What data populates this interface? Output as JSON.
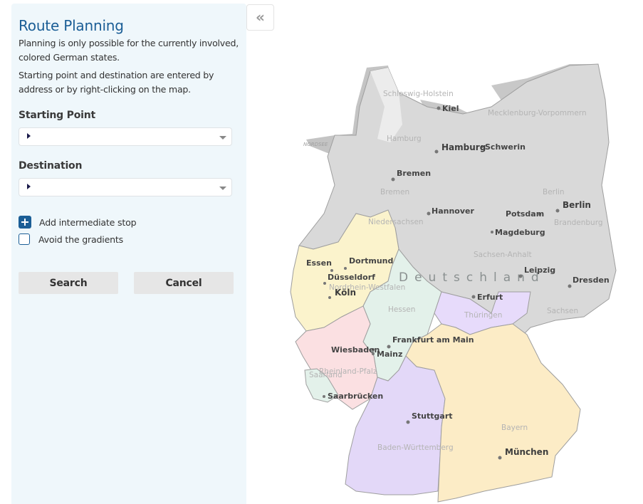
{
  "sidebar": {
    "title": "Route Planning",
    "description_1": "Planning is only possible for the currently involved, colored German states.",
    "description_2": "Starting point and destination are entered by address or by right-clicking on the map.",
    "starting_point": {
      "label": "Starting Point",
      "value": ""
    },
    "destination": {
      "label": "Destination",
      "value": ""
    },
    "add_stop_label": "Add intermediate stop",
    "avoid_gradients_label": "Avoid the gradients",
    "avoid_gradients_checked": false,
    "search_label": "Search",
    "cancel_label": "Cancel",
    "accent_color": "#1b5e96"
  },
  "collapse_button": {
    "icon": "double-chevron-left-icon",
    "glyph": "«"
  },
  "map": {
    "country_label": "Deutschland",
    "sea_label": "NORDSEE",
    "state_colors": {
      "inactive": "#d9d9d9",
      "nordrhein_westfalen": "#fbf3cc",
      "hessen": "#e3f1ea",
      "rheinland_pfalz": "#fbe0e2",
      "saarland": "#e3f1ea",
      "thueringen": "#e7dbfb",
      "baden_wuerttemberg": "#e3d8f8",
      "bayern": "#fcecc6"
    },
    "states": [
      "Schleswig-Holstein",
      "Hamburg",
      "Mecklenburg-Vorpommern",
      "Bremen",
      "Niedersachsen",
      "Berlin",
      "Brandenburg",
      "Sachsen-Anhalt",
      "Nordrhein-Westfalen",
      "Hessen",
      "Thüringen",
      "Sachsen",
      "Rheinland-Pfalz",
      "Saarland",
      "Baden-Württemberg",
      "Bayern"
    ],
    "cities": [
      "Kiel",
      "Hamburg",
      "Schwerin",
      "Bremen",
      "Hannover",
      "Berlin",
      "Potsdam",
      "Magdeburg",
      "Essen",
      "Dortmund",
      "Düsseldorf",
      "Köln",
      "Leipzig",
      "Dresden",
      "Erfurt",
      "Frankfurt am Main",
      "Wiesbaden",
      "Mainz",
      "Saarbrücken",
      "Stuttgart",
      "München"
    ]
  }
}
